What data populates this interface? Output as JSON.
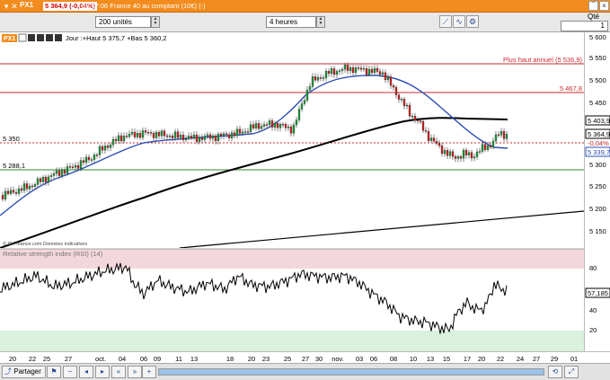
{
  "titlebar": {
    "name": "PX1",
    "price": "5 364,9 (-0,04%)",
    "status": "08:47:06 France 40 au comptant (10€) (-)"
  },
  "toolbar": {
    "units_value": "200 unités",
    "period_value": "4 heures",
    "qty_label": "Qté",
    "qty_value": "1"
  },
  "chart": {
    "badge": "PX1",
    "info": "Jour :+Haut 5 375,7 +Bas 5 360,2",
    "source": "© IT-Finance.com Données indicatives",
    "annual_high_label": "Plus haut annuel (5 536,9)",
    "level_5467": "5 467,8",
    "level_5350": "5 350",
    "level_5288": "5 288,1",
    "tag_ma": "5 403,9",
    "tag_price": "5 364,9",
    "tag_change": "-0,04%",
    "tag_ma2": "5 339,7",
    "y_ticks": [
      "5 600",
      "5 550",
      "5 500",
      "5 450",
      "5 400",
      "5 300",
      "5 250",
      "5 200",
      "5 150"
    ]
  },
  "rsi": {
    "title": "Relative strength index (RSI) (14)",
    "value_tag": "57,185",
    "y_ticks": [
      "80",
      "60",
      "40",
      "20"
    ]
  },
  "xaxis": {
    "labels": [
      "20",
      "22",
      "25",
      "27",
      "oct.",
      "04",
      "06",
      "09",
      "11",
      "13",
      "18",
      "20",
      "23",
      "25",
      "27",
      "30",
      "nov.",
      "03",
      "06",
      "08",
      "10",
      "13",
      "15",
      "17",
      "20",
      "22",
      "24",
      "27",
      "29",
      "01"
    ]
  },
  "bottombar": {
    "share_label": "Partager"
  },
  "colors": {
    "accent": "#f28c1e",
    "price_up": "#1c9a3a",
    "price_down": "#d11f1f",
    "ma_fast": "#2c4fb5",
    "ma_slow": "#000000",
    "resistance": "#c8282c",
    "support": "#2e8b2e",
    "rsi_overbought": "#f4d7dc",
    "rsi_oversold": "#d9f1dd"
  }
}
